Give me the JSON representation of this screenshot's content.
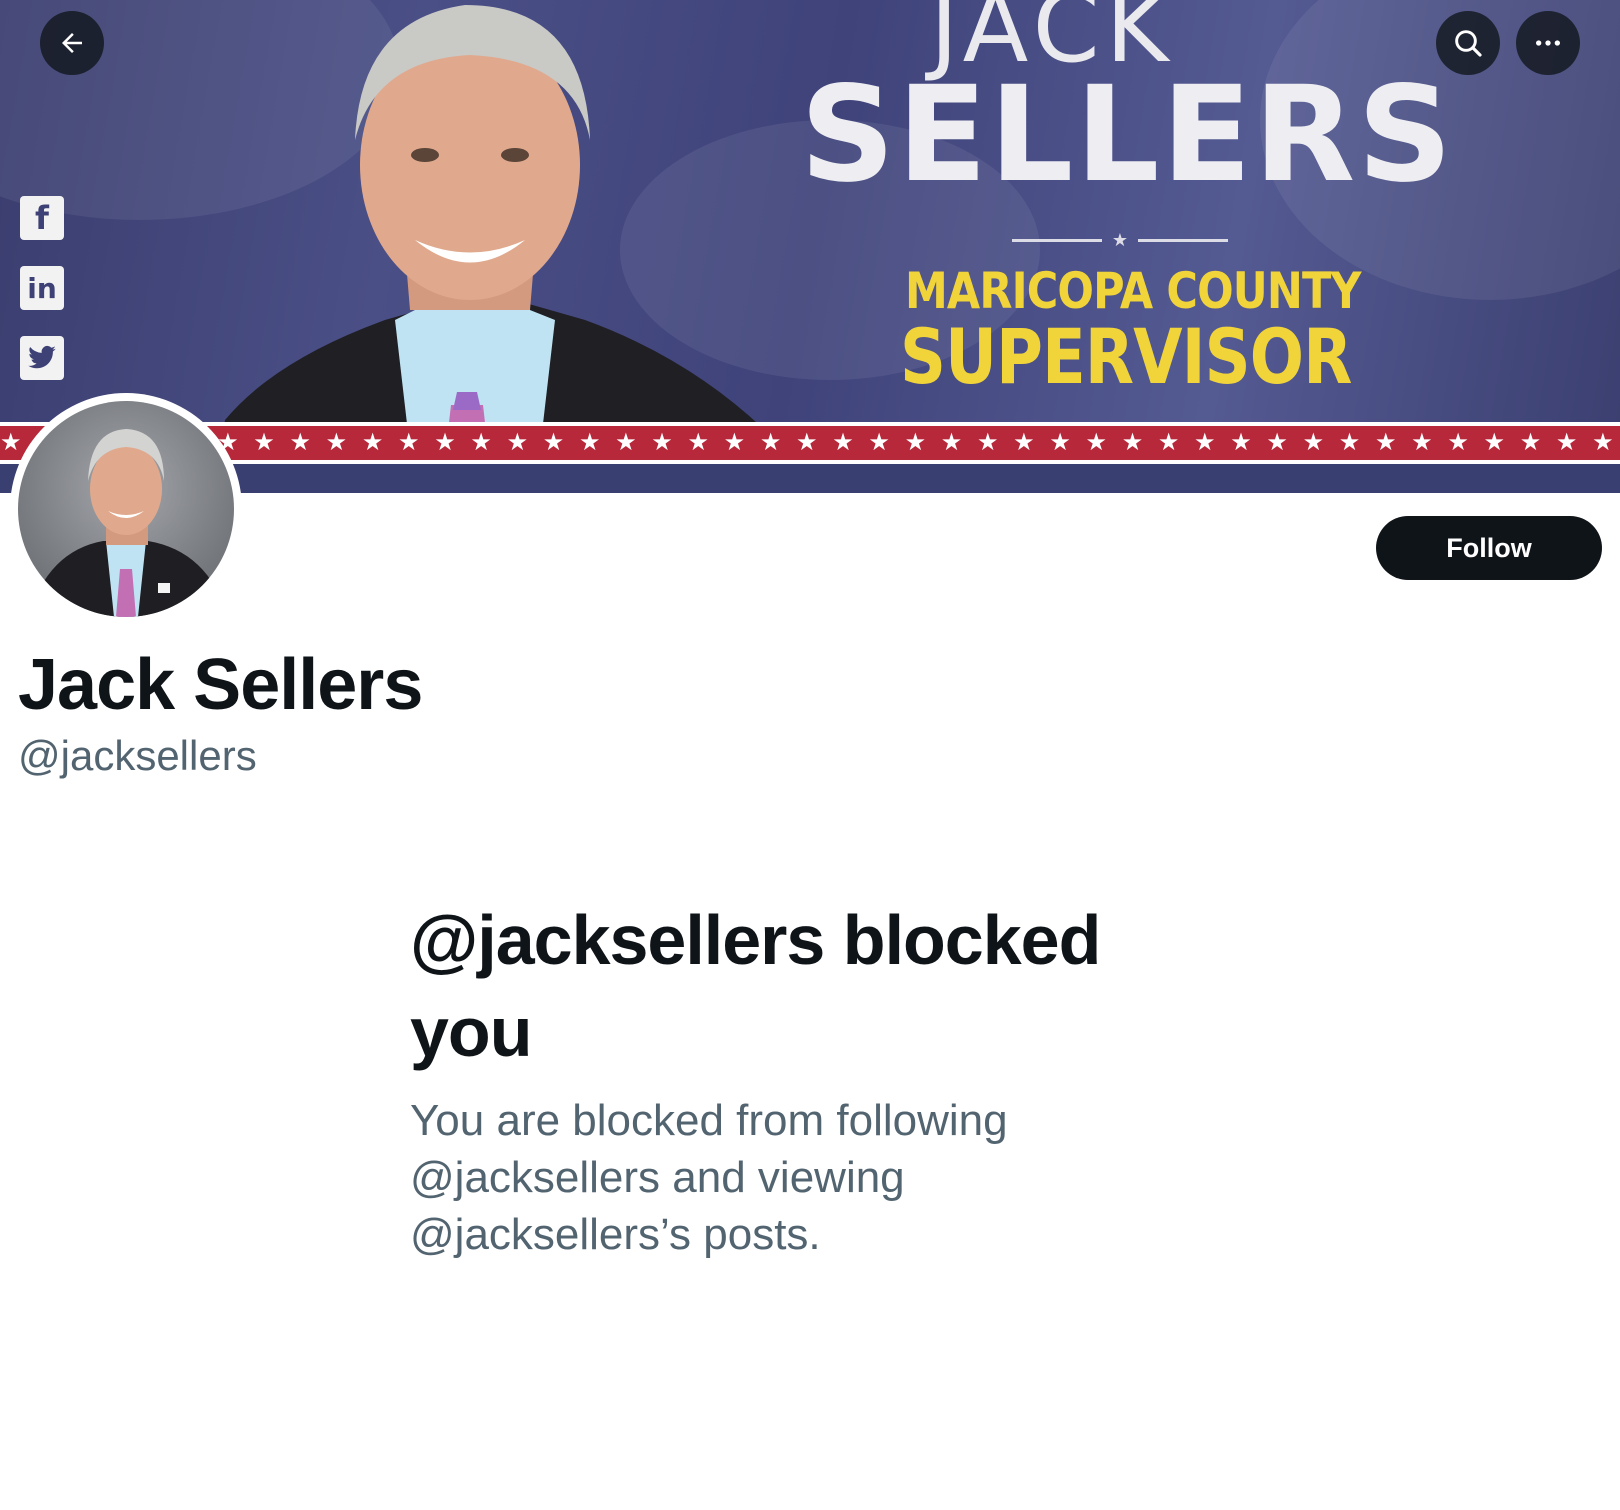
{
  "banner": {
    "headline_small": "JACK",
    "headline_large": "SELLERS",
    "subline_1": "MARICOPA COUNTY",
    "subline_2": "SUPERVISOR",
    "social_icons": [
      "facebook-icon",
      "linkedin-icon",
      "twitter-icon"
    ],
    "colors": {
      "navy": "#3f437a",
      "gold": "#f1d43a",
      "red": "#b7283a"
    }
  },
  "top_actions": {
    "back_icon": "back-arrow-icon",
    "search_icon": "search-icon",
    "more_icon": "more-options-icon"
  },
  "profile": {
    "display_name": "Jack Sellers",
    "handle": "@jacksellers",
    "follow_label": "Follow"
  },
  "blocked": {
    "title": "@jacksellers blocked you",
    "message": "You are blocked from following @jacksellers and viewing @jacksellers’s posts."
  }
}
